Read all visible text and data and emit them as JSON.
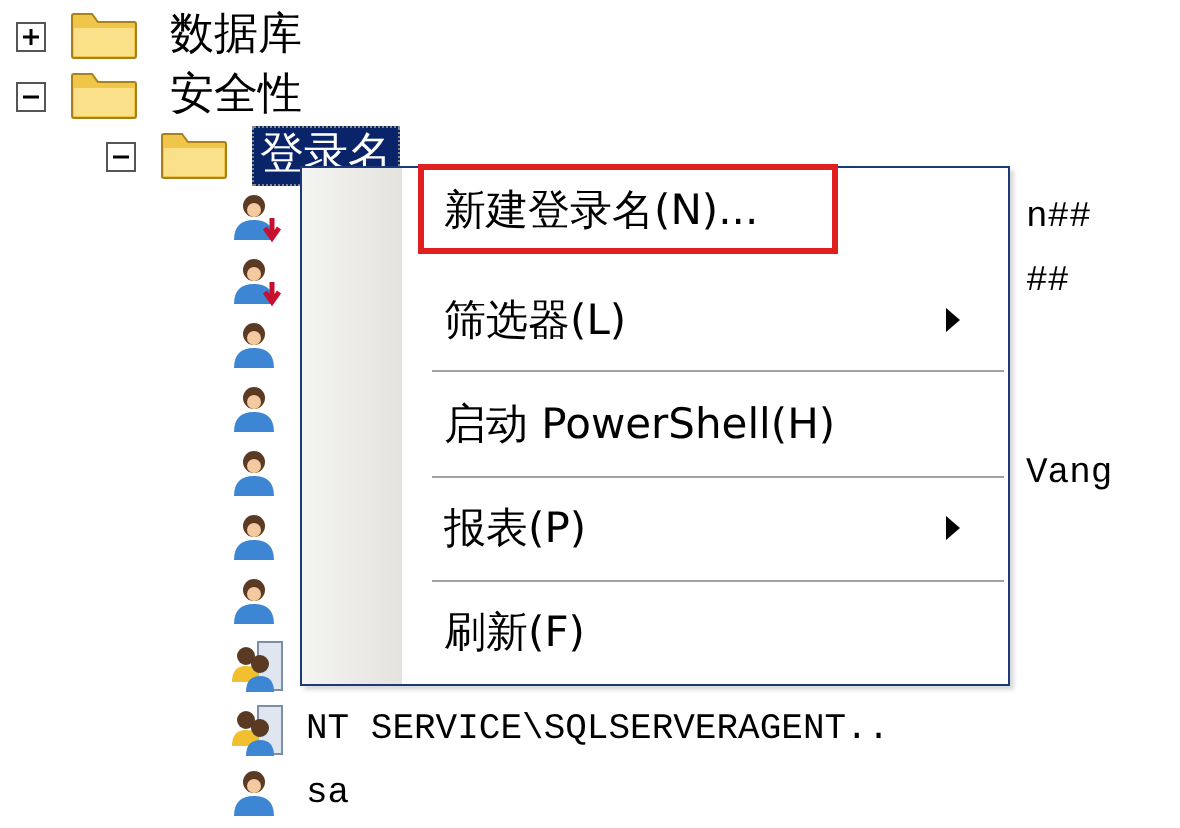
{
  "tree": [
    {
      "kind": "folder",
      "label": "数据库",
      "expanded": false
    },
    {
      "kind": "folder",
      "label": "安全性",
      "expanded": true,
      "children": [
        {
          "kind": "folder",
          "label": "登录名",
          "expanded": true,
          "selected": true,
          "children": [
            {
              "kind": "disabled-user",
              "label": "n##",
              "partial": true
            },
            {
              "kind": "disabled-user",
              "label": "##",
              "partial": true
            },
            {
              "kind": "user"
            },
            {
              "kind": "user"
            },
            {
              "kind": "user",
              "label": "Vang",
              "partial": true
            },
            {
              "kind": "user"
            },
            {
              "kind": "user"
            },
            {
              "kind": "group"
            },
            {
              "kind": "group",
              "label": "NT SERVICE\\SQLSERVERAGENT..",
              "partial": false
            },
            {
              "kind": "user",
              "label": "sa",
              "partial": false
            }
          ]
        }
      ]
    }
  ],
  "context_menu": {
    "items": [
      {
        "kind": "item",
        "label": "新建登录名(N)...",
        "submenu": false,
        "highlighted": true
      },
      {
        "kind": "item",
        "label": "筛选器(L)",
        "submenu": true,
        "highlighted": false
      },
      {
        "kind": "separator"
      },
      {
        "kind": "item",
        "label": "启动 PowerShell(H)",
        "submenu": false,
        "highlighted": false
      },
      {
        "kind": "separator"
      },
      {
        "kind": "item",
        "label": "报表(P)",
        "submenu": true,
        "highlighted": false
      },
      {
        "kind": "separator"
      },
      {
        "kind": "item",
        "label": "刷新(F)",
        "submenu": false,
        "highlighted": false
      }
    ]
  }
}
